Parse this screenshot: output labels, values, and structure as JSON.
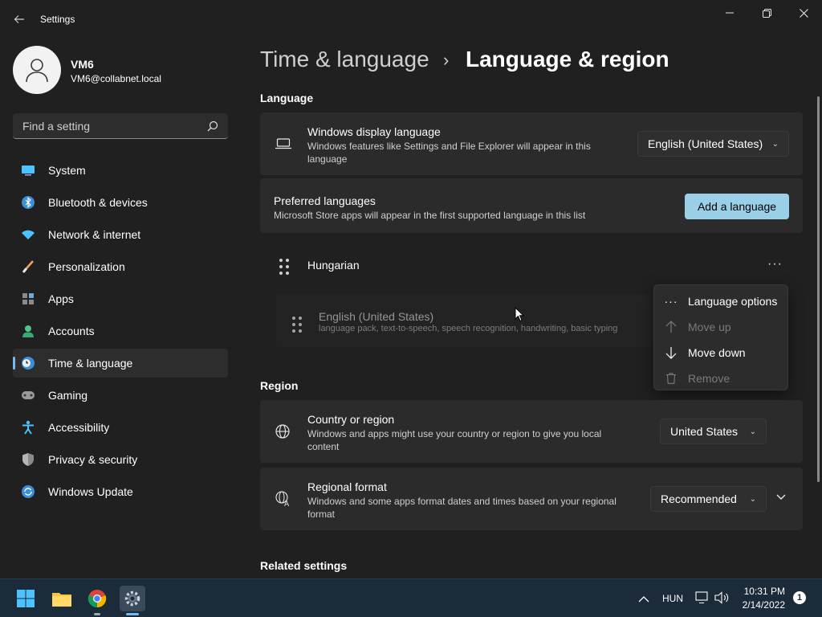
{
  "window": {
    "title": "Settings",
    "controls": {
      "minimize": "minimize-icon",
      "maximize": "restore-icon",
      "close": "close-icon"
    }
  },
  "user": {
    "name": "VM6",
    "email": "VM6@collabnet.local"
  },
  "search": {
    "placeholder": "Find a setting"
  },
  "sidebar": {
    "items": [
      {
        "label": "System",
        "icon": "monitor-icon"
      },
      {
        "label": "Bluetooth & devices",
        "icon": "bluetooth-icon"
      },
      {
        "label": "Network & internet",
        "icon": "wifi-icon"
      },
      {
        "label": "Personalization",
        "icon": "brush-icon"
      },
      {
        "label": "Apps",
        "icon": "apps-icon"
      },
      {
        "label": "Accounts",
        "icon": "person-icon"
      },
      {
        "label": "Time & language",
        "icon": "clock-globe-icon",
        "active": true
      },
      {
        "label": "Gaming",
        "icon": "gamepad-icon"
      },
      {
        "label": "Accessibility",
        "icon": "accessibility-icon"
      },
      {
        "label": "Privacy & security",
        "icon": "shield-icon"
      },
      {
        "label": "Windows Update",
        "icon": "update-icon"
      }
    ]
  },
  "header": {
    "parent": "Time & language",
    "separator": "›",
    "current": "Language & region"
  },
  "language": {
    "section_title": "Language",
    "display_language": {
      "title": "Windows display language",
      "description": "Windows features like Settings and File Explorer will appear in this language",
      "value": "English (United States)"
    },
    "preferred": {
      "title": "Preferred languages",
      "description": "Microsoft Store apps will appear in the first supported language in this list",
      "add_button": "Add a language",
      "items": [
        {
          "name": "Hungarian",
          "detail": ""
        },
        {
          "name": "English (United States)",
          "detail": "language pack, text-to-speech, speech recognition, handwriting, basic typing"
        }
      ]
    }
  },
  "context_menu": {
    "items": [
      {
        "label": "Language options",
        "icon": "more-icon",
        "enabled": true
      },
      {
        "label": "Move up",
        "icon": "arrow-up-icon",
        "enabled": false
      },
      {
        "label": "Move down",
        "icon": "arrow-down-icon",
        "enabled": true
      },
      {
        "label": "Remove",
        "icon": "trash-icon",
        "enabled": false
      }
    ]
  },
  "region": {
    "section_title": "Region",
    "country": {
      "title": "Country or region",
      "description": "Windows and apps might use your country or region to give you local content",
      "value": "United States"
    },
    "format": {
      "title": "Regional format",
      "description": "Windows and some apps format dates and times based on your regional format",
      "value": "Recommended"
    }
  },
  "related": {
    "section_title": "Related settings"
  },
  "taskbar": {
    "apps": [
      "windows-start-icon",
      "file-explorer-icon",
      "chrome-icon",
      "settings-icon"
    ],
    "tray": {
      "language": "HUN",
      "time": "10:31 PM",
      "date": "2/14/2022",
      "notifications": "1"
    }
  },
  "colors": {
    "background": "#202020",
    "card": "#2b2b2b",
    "accent": "#99d0e8",
    "active_indicator": "#76b9ed",
    "taskbar": "#1c2b3a"
  }
}
